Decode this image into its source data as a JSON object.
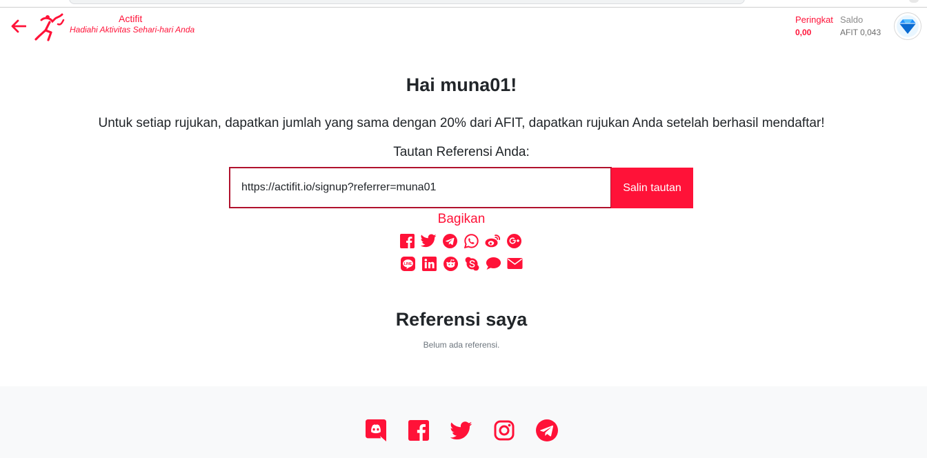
{
  "brand": {
    "name": "Actifit",
    "tagline": "Hadiahi Aktivitas Sehari-hari Anda",
    "accent": "#ff1238"
  },
  "stats": {
    "rank_label": "Peringkat",
    "rank_value": "0,00",
    "balance_label": "Saldo",
    "balance_value": "AFIT 0,043"
  },
  "main": {
    "greeting": "Hai muna01!",
    "description": "Untuk setiap rujukan, dapatkan jumlah yang sama dengan 20% dari AFIT, dapatkan rujukan Anda setelah berhasil mendaftar!",
    "ref_label": "Tautan Referensi Anda:",
    "ref_link": "https://actifit.io/signup?referrer=muna01",
    "copy_label": "Salin tautan",
    "share_label": "Bagikan",
    "share_icons_row1": [
      "facebook-icon",
      "twitter-icon",
      "telegram-icon",
      "whatsapp-icon",
      "weibo-icon",
      "google-plus-icon"
    ],
    "share_icons_row2": [
      "line-icon",
      "linkedin-icon",
      "reddit-icon",
      "skype-icon",
      "sms-icon",
      "email-icon"
    ],
    "my_refs_title": "Referensi saya",
    "no_refs_text": "Belum ada referensi."
  },
  "footer": {
    "icons": [
      "discord-icon",
      "facebook-icon",
      "twitter-icon",
      "instagram-icon",
      "telegram-icon"
    ]
  }
}
